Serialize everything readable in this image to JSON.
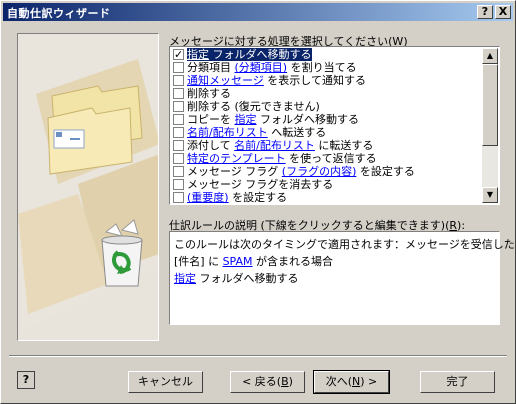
{
  "window": {
    "title": "自動仕訳ウィザード",
    "help_btn": "?",
    "close_btn": "X"
  },
  "actions_label_pre": "メッセージに対する処理を選択してください(",
  "actions_label_key": "W",
  "actions_label_post": ")",
  "actions": [
    {
      "checked": true,
      "selected": true,
      "pre": "",
      "link": "指定",
      "post": " フォルダへ移動する"
    },
    {
      "checked": false,
      "selected": false,
      "pre": "分類項目 ",
      "link": "(分類項目)",
      "post": " を割り当てる"
    },
    {
      "checked": false,
      "selected": false,
      "pre": "",
      "link": "通知メッセージ",
      "post": " を表示して通知する"
    },
    {
      "checked": false,
      "selected": false,
      "pre": "削除する",
      "link": "",
      "post": ""
    },
    {
      "checked": false,
      "selected": false,
      "pre": "削除する (復元できません)",
      "link": "",
      "post": ""
    },
    {
      "checked": false,
      "selected": false,
      "pre": "コピーを ",
      "link": "指定",
      "post": " フォルダへ移動する"
    },
    {
      "checked": false,
      "selected": false,
      "pre": "",
      "link": "名前/配布リスト",
      "post": " へ転送する"
    },
    {
      "checked": false,
      "selected": false,
      "pre": "添付して ",
      "link": "名前/配布リスト",
      "post": " に転送する"
    },
    {
      "checked": false,
      "selected": false,
      "pre": "",
      "link": "特定のテンプレート",
      "post": " を使って返信する"
    },
    {
      "checked": false,
      "selected": false,
      "pre": "メッセージ フラグ ",
      "link": "(フラグの内容)",
      "post": " を設定する"
    },
    {
      "checked": false,
      "selected": false,
      "pre": "メッセージ フラグを消去する",
      "link": "",
      "post": ""
    },
    {
      "checked": false,
      "selected": false,
      "pre": "",
      "link": "(重要度)",
      "post": " を設定する"
    }
  ],
  "desc_label_pre": "仕訳ルールの説明 (下線をクリックすると編集できます)(",
  "desc_label_key": "R",
  "desc_label_post": "):",
  "description": {
    "line1": "このルールは次のタイミングで適用されます：メッセージを受信したとき",
    "line2_pre": "[件名] に ",
    "line2_link": "SPAM",
    "line2_post": " が含まれる場合",
    "line3_link": "指定",
    "line3_post": " フォルダへ移動する"
  },
  "buttons": {
    "help": "?",
    "cancel": "キャンセル",
    "back_pre": "< 戻る(",
    "back_key": "B",
    "back_post": ")",
    "next_pre": "次へ(",
    "next_key": "N",
    "next_post": ") >",
    "finish": "完了"
  },
  "scroll": {
    "up": "▲",
    "down": "▼"
  }
}
